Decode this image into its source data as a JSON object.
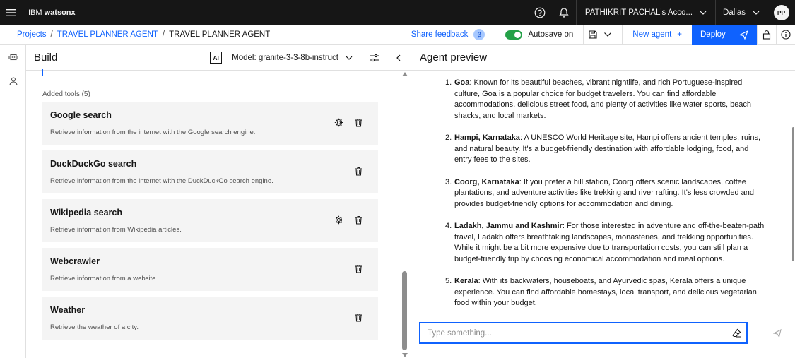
{
  "topbar": {
    "brand_prefix": "IBM",
    "brand_product": "watsonx",
    "account": "PATHIKRIT PACHAL's Acco...",
    "region": "Dallas",
    "avatar_initials": "PP"
  },
  "breadcrumb": {
    "items": [
      "Projects",
      "TRAVEL PLANNER AGENT",
      "TRAVEL PLANNER AGENT"
    ],
    "separator": "/"
  },
  "actions": {
    "share_feedback": "Share feedback",
    "beta_badge": "β",
    "autosave_label": "Autosave on",
    "autosave_on": true,
    "new_agent": "New agent",
    "new_agent_icon": "+",
    "deploy": "Deploy"
  },
  "build": {
    "title": "Build",
    "ai_badge": "AI",
    "model_label": "Model: granite-3-3-8b-instruct",
    "added_tools_label": "Added tools (5)",
    "tools": [
      {
        "name": "Google search",
        "description": "Retrieve information from the internet with the Google search engine.",
        "has_settings": true
      },
      {
        "name": "DuckDuckGo search",
        "description": "Retrieve information from the internet with the DuckDuckGo search engine.",
        "has_settings": false
      },
      {
        "name": "Wikipedia search",
        "description": "Retrieve information from Wikipedia articles.",
        "has_settings": true
      },
      {
        "name": "Webcrawler",
        "description": "Retrieve information from a website.",
        "has_settings": false
      },
      {
        "name": "Weather",
        "description": "Retrieve the weather of a city.",
        "has_settings": false
      }
    ]
  },
  "preview": {
    "title": "Agent preview",
    "composer_placeholder": "Type something...",
    "messages": [
      {
        "num": "1.",
        "place": "Goa",
        "text": ": Known for its beautiful beaches, vibrant nightlife, and rich Portuguese-inspired culture, Goa is a popular choice for budget travelers. You can find affordable accommodations, delicious street food, and plenty of activities like water sports, beach shacks, and local markets."
      },
      {
        "num": "2.",
        "place": "Hampi, Karnataka",
        "text": ": A UNESCO World Heritage site, Hampi offers ancient temples, ruins, and natural beauty. It's a budget-friendly destination with affordable lodging, food, and entry fees to the sites."
      },
      {
        "num": "3.",
        "place": "Coorg, Karnataka",
        "text": ": If you prefer a hill station, Coorg offers scenic landscapes, coffee plantations, and adventure activities like trekking and river rafting. It's less crowded and provides budget-friendly options for accommodation and dining."
      },
      {
        "num": "4.",
        "place": "Ladakh, Jammu and Kashmir",
        "text": ": For those interested in adventure and off-the-beaten-path travel, Ladakh offers breathtaking landscapes, monasteries, and trekking opportunities. While it might be a bit more expensive due to transportation costs, you can still plan a budget-friendly trip by choosing economical accommodation and meal options."
      },
      {
        "num": "5.",
        "place": "Kerala",
        "text": ": With its backwaters, houseboats, and Ayurvedic spas, Kerala offers a unique experience. You can find affordable homestays, local transport, and delicious vegetarian food within your budget."
      }
    ]
  },
  "icons": {
    "menu": "hamburger-menu-icon",
    "help": "help-icon",
    "notification": "bell-icon",
    "save": "save-icon",
    "deploy": "send-icon",
    "lock": "lock-icon",
    "info": "info-icon",
    "settings": "gear-icon",
    "delete": "trash-icon",
    "tune": "sliders-icon",
    "collapse": "chevron-left-icon",
    "clear": "eraser-icon",
    "send": "send-icon"
  },
  "colors": {
    "accent": "#0f62fe",
    "topbar": "#161616",
    "toggle_on": "#24a148",
    "tile": "#f4f4f4"
  }
}
